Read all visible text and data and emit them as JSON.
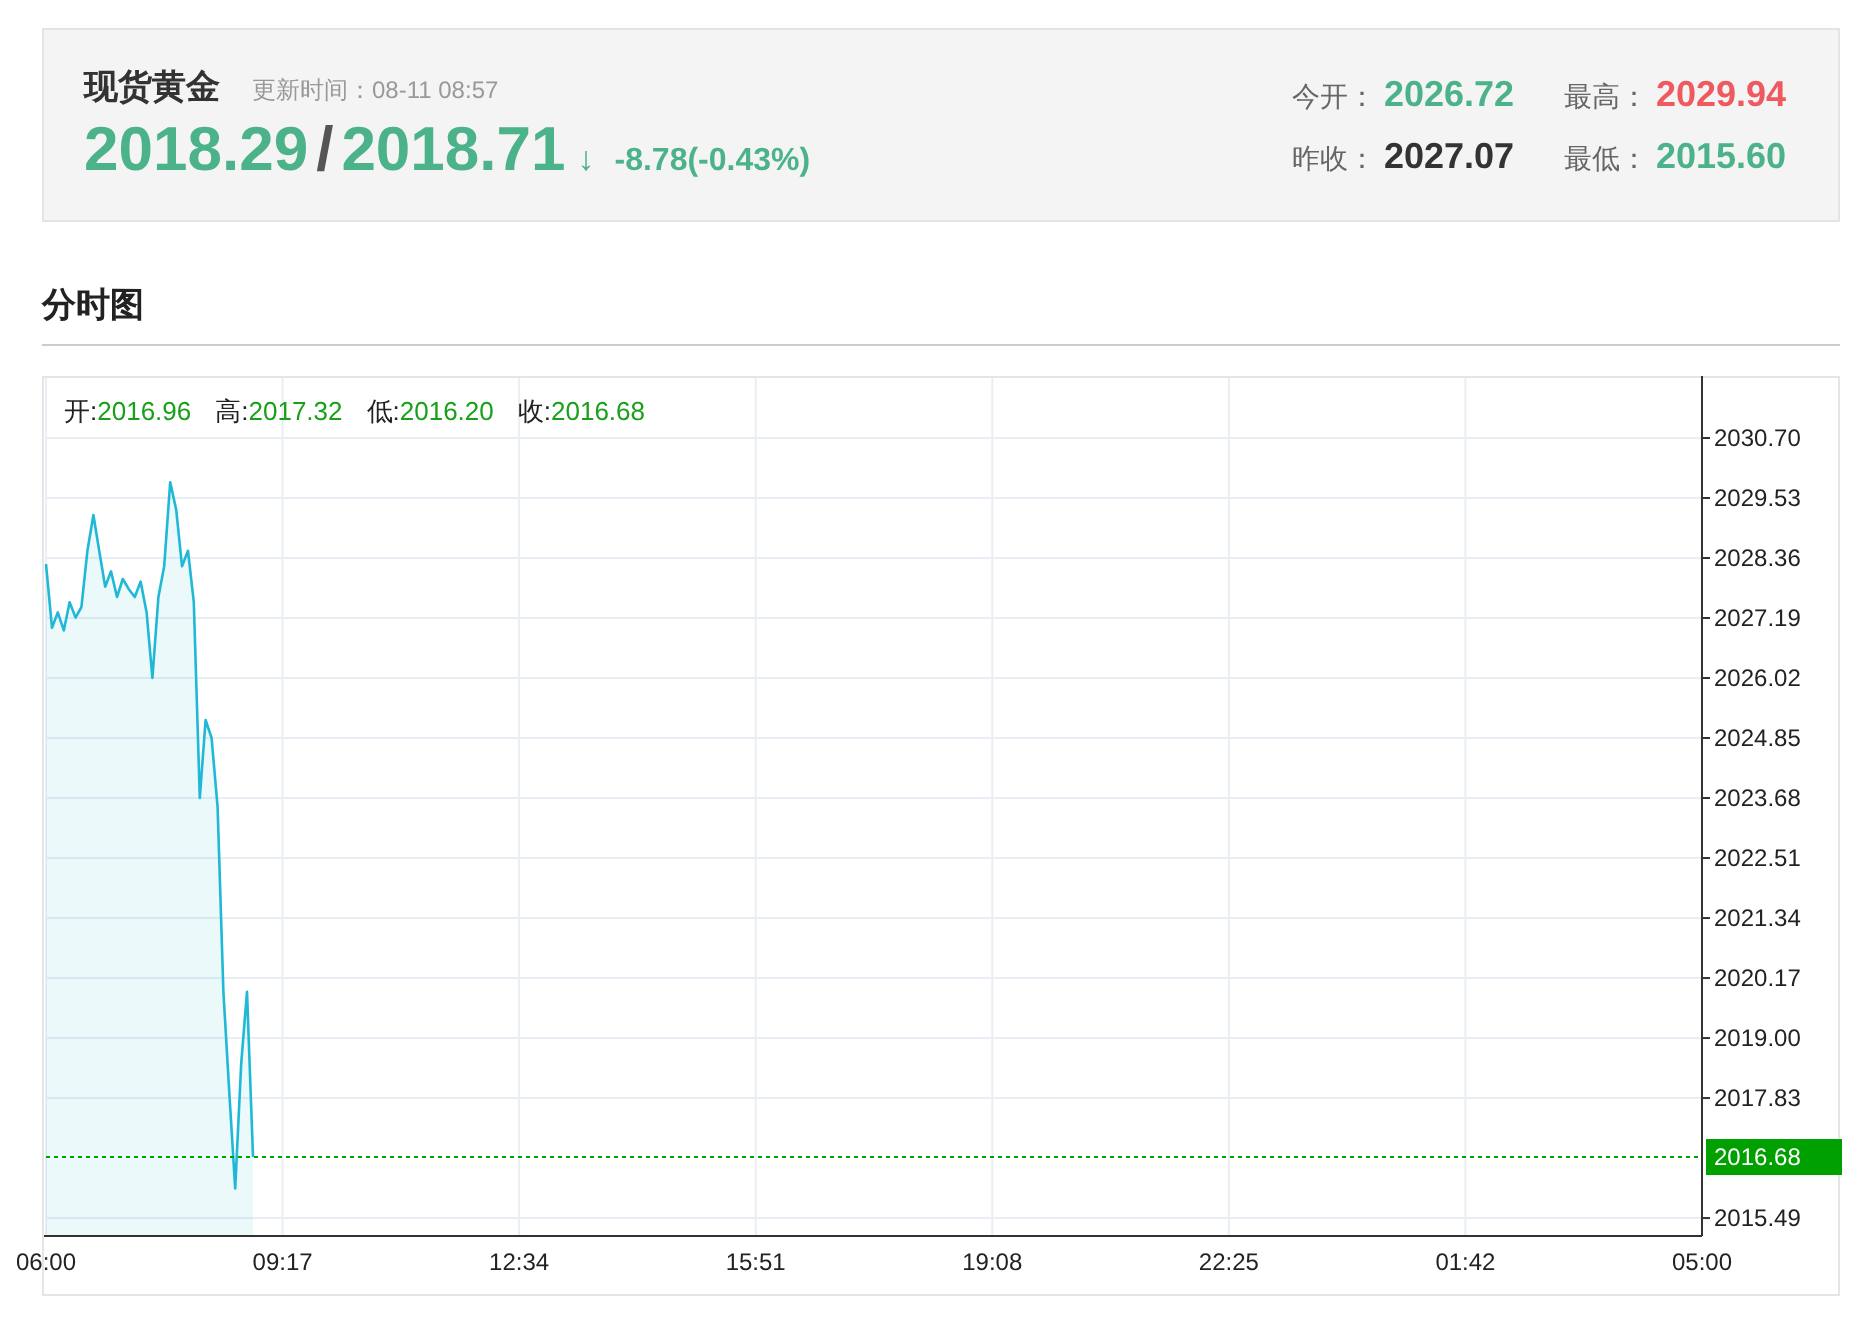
{
  "quote": {
    "title": "现货黄金",
    "updated": "更新时间：08-11 08:57",
    "bid": "2018.29",
    "separator": "/",
    "ask": "2018.71",
    "arrow": "↓",
    "change": "-8.78(-0.43%)",
    "stats": [
      {
        "label": "今开：",
        "value": "2026.72",
        "color": "#4cb28a"
      },
      {
        "label": "最高：",
        "value": "2029.94",
        "color": "#ee5a5f"
      },
      {
        "label": "昨收：",
        "value": "2027.07",
        "color": "#333333"
      },
      {
        "label": "最低：",
        "value": "2015.60",
        "color": "#4cb28a"
      }
    ]
  },
  "section": {
    "title": "分时图"
  },
  "chart": {
    "ohlc": [
      {
        "label": "开:",
        "value": "2016.96"
      },
      {
        "label": "高:",
        "value": "2017.32"
      },
      {
        "label": "低:",
        "value": "2016.20"
      },
      {
        "label": "收:",
        "value": "2016.68"
      }
    ],
    "chart_data": {
      "type": "area",
      "grid": true,
      "ylim": [
        2015.14,
        2031.87
      ],
      "categories": [
        "06:00",
        null,
        null,
        null,
        null,
        null,
        null,
        null,
        null,
        null,
        null,
        null,
        null,
        null,
        null,
        null,
        null,
        null,
        null,
        null,
        null,
        null,
        null,
        null,
        null,
        null,
        null,
        null,
        null,
        null,
        null,
        null,
        null,
        null,
        null,
        null,
        null,
        null,
        null,
        null,
        "09:17",
        null,
        null,
        null,
        null,
        null,
        null,
        null,
        null,
        null,
        null,
        null,
        null,
        null,
        null,
        null,
        null,
        null,
        null,
        null,
        null,
        null,
        null,
        null,
        null,
        null,
        null,
        null,
        null,
        null,
        null,
        null,
        null,
        null,
        null,
        null,
        null,
        null,
        null,
        null,
        "12:34",
        null,
        null,
        null,
        null,
        null,
        null,
        null,
        null,
        null,
        null,
        null,
        null,
        null,
        null,
        null,
        null,
        null,
        null,
        null,
        null,
        null,
        null,
        null,
        null,
        null,
        null,
        null,
        null,
        null,
        null,
        null,
        null,
        null,
        null,
        null,
        null,
        null,
        null,
        null,
        "15:51",
        null,
        null,
        null,
        null,
        null,
        null,
        null,
        null,
        null,
        null,
        null,
        null,
        null,
        null,
        null,
        null,
        null,
        null,
        null,
        null,
        null,
        null,
        null,
        null,
        null,
        null,
        null,
        null,
        null,
        null,
        null,
        null,
        null,
        null,
        null,
        null,
        null,
        null,
        null,
        "19:08",
        null,
        null,
        null,
        null,
        null,
        null,
        null,
        null,
        null,
        null,
        null,
        null,
        null,
        null,
        null,
        null,
        null,
        null,
        null,
        null,
        null,
        null,
        null,
        null,
        null,
        null,
        null,
        null,
        null,
        null,
        null,
        null,
        null,
        null,
        null,
        null,
        null,
        null,
        null,
        "22:25",
        null,
        null,
        null,
        null,
        null,
        null,
        null,
        null,
        null,
        null,
        null,
        null,
        null,
        null,
        null,
        null,
        null,
        null,
        null,
        null,
        null,
        null,
        null,
        null,
        null,
        null,
        null,
        null,
        null,
        null,
        null,
        null,
        null,
        null,
        null,
        null,
        null,
        null,
        null,
        "01:42",
        null,
        null,
        null,
        null,
        null,
        null,
        null,
        null,
        null,
        null,
        null,
        null,
        null,
        null,
        null,
        null,
        null,
        null,
        null,
        null,
        null,
        null,
        null,
        null,
        null,
        null,
        null,
        null,
        null,
        null,
        null,
        null,
        null,
        null,
        null,
        null,
        null,
        null,
        null,
        "05:00"
      ],
      "series": [
        {
          "color": "#1fb8d6",
          "values": [
            2028.24,
            2027.0,
            2027.3,
            2026.95,
            2027.5,
            2027.2,
            2027.4,
            2028.5,
            2029.2,
            2028.5,
            2027.8,
            2028.1,
            2027.6,
            2027.95,
            2027.75,
            2027.6,
            2027.9,
            2027.3,
            2026.02,
            2027.6,
            2028.2,
            2029.84,
            2029.3,
            2028.2,
            2028.5,
            2027.5,
            2023.68,
            2025.2,
            2024.85,
            2023.5,
            2019.9,
            2017.9,
            2016.07,
            2018.5,
            2019.9,
            2016.68,
            null,
            null,
            null,
            null,
            null,
            null,
            null,
            null,
            null,
            null,
            null,
            null,
            null,
            null,
            null,
            null,
            null,
            null,
            null,
            null,
            null,
            null,
            null,
            null,
            null,
            null,
            null,
            null,
            null,
            null,
            null,
            null,
            null,
            null,
            null,
            null,
            null,
            null,
            null,
            null,
            null,
            null,
            null,
            null,
            null,
            null,
            null,
            null,
            null,
            null,
            null,
            null,
            null,
            null,
            null,
            null,
            null,
            null,
            null,
            null,
            null,
            null,
            null,
            null,
            null,
            null,
            null,
            null,
            null,
            null,
            null,
            null,
            null,
            null,
            null,
            null,
            null,
            null,
            null,
            null,
            null,
            null,
            null,
            null,
            null,
            null,
            null,
            null,
            null,
            null,
            null,
            null,
            null,
            null,
            null,
            null,
            null,
            null,
            null,
            null,
            null,
            null,
            null,
            null,
            null,
            null,
            null,
            null,
            null,
            null,
            null,
            null,
            null,
            null,
            null,
            null,
            null,
            null,
            null,
            null,
            null,
            null,
            null,
            null,
            null,
            null,
            null,
            null,
            null,
            null,
            null,
            null,
            null,
            null,
            null,
            null,
            null,
            null,
            null,
            null,
            null,
            null,
            null,
            null,
            null,
            null,
            null,
            null,
            null,
            null,
            null,
            null,
            null,
            null,
            null,
            null,
            null,
            null,
            null,
            null,
            null,
            null,
            null,
            null,
            null,
            null,
            null,
            null,
            null,
            null,
            null,
            null,
            null,
            null,
            null,
            null,
            null,
            null,
            null,
            null,
            null,
            null,
            null,
            null,
            null,
            null,
            null,
            null,
            null,
            null,
            null,
            null,
            null,
            null,
            null,
            null,
            null,
            null,
            null,
            null,
            null,
            null,
            null,
            null,
            null,
            null,
            null,
            null,
            null,
            null,
            null,
            null,
            null,
            null,
            null,
            null,
            null,
            null,
            null,
            null,
            null,
            null,
            null,
            null,
            null,
            null,
            null,
            null,
            null,
            null,
            null,
            null,
            null,
            null,
            null,
            null,
            null,
            null,
            null,
            null,
            null,
            null,
            null,
            null,
            null
          ]
        }
      ],
      "yticks": [
        {
          "value": 2030.7,
          "label": "2030.70"
        },
        {
          "value": 2029.53,
          "label": "2029.53"
        },
        {
          "value": 2028.36,
          "label": "2028.36"
        },
        {
          "value": 2027.19,
          "label": "2027.19"
        },
        {
          "value": 2026.02,
          "label": "2026.02"
        },
        {
          "value": 2024.85,
          "label": "2024.85"
        },
        {
          "value": 2023.68,
          "label": "2023.68"
        },
        {
          "value": 2022.51,
          "label": "2022.51"
        },
        {
          "value": 2021.34,
          "label": "2021.34"
        },
        {
          "value": 2020.17,
          "label": "2020.17"
        },
        {
          "value": 2019.0,
          "label": "2019.00"
        },
        {
          "value": 2017.83,
          "label": "2017.83"
        },
        {
          "value": 2015.49,
          "label": "2015.49"
        }
      ],
      "ref_lines": [
        {
          "axis": "y",
          "value": 2016.68,
          "label": "2016.68"
        }
      ]
    }
  }
}
